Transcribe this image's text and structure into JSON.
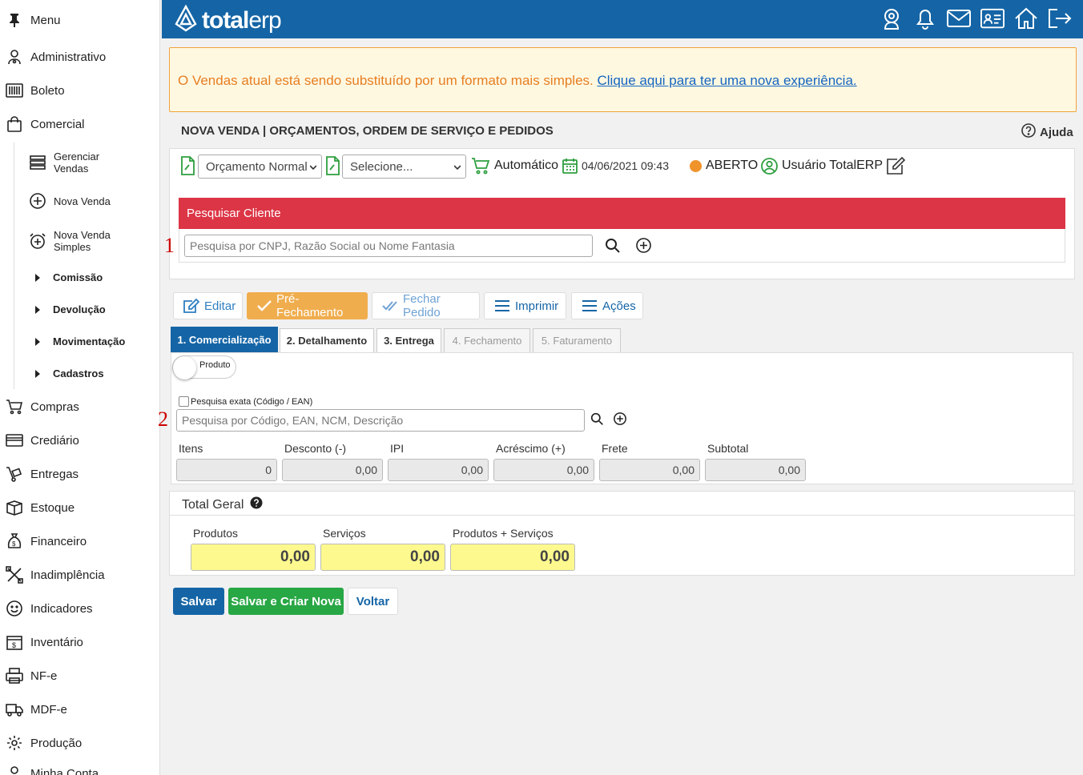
{
  "sidebar": {
    "menu_label": "Menu",
    "items": [
      {
        "label": "Administrativo",
        "icon": "admin-icon"
      },
      {
        "label": "Boleto",
        "icon": "barcode-icon"
      },
      {
        "label": "Comercial",
        "icon": "shopping-bag-icon"
      }
    ],
    "comercial_sub": [
      {
        "label": "Gerenciar Vendas",
        "icon": "list-icon"
      },
      {
        "label": "Nova Venda",
        "icon": "plus-circle-icon"
      },
      {
        "label": "Nova Venda Simples",
        "icon": "alarm-plus-icon"
      }
    ],
    "comercial_groups": [
      "Comissão",
      "Devolução",
      "Movimentação",
      "Cadastros"
    ],
    "items_after": [
      {
        "label": "Compras",
        "icon": "cart-icon"
      },
      {
        "label": "Crediário",
        "icon": "card-icon"
      },
      {
        "label": "Entregas",
        "icon": "dolly-icon"
      },
      {
        "label": "Estoque",
        "icon": "box-icon"
      },
      {
        "label": "Financeiro",
        "icon": "money-bag-icon"
      },
      {
        "label": "Inadimplência",
        "icon": "tools-icon"
      },
      {
        "label": "Indicadores",
        "icon": "smile-icon"
      },
      {
        "label": "Inventário",
        "icon": "inventory-icon"
      },
      {
        "label": "NF-e",
        "icon": "printer-icon"
      },
      {
        "label": "MDF-e",
        "icon": "truck-icon"
      },
      {
        "label": "Produção",
        "icon": "gear-icon"
      },
      {
        "label": "Minha Conta",
        "icon": "user-icon"
      }
    ]
  },
  "header": {
    "logo_bold": "total",
    "logo_light": "erp",
    "icons": [
      "support-icon",
      "bell-icon",
      "mail-icon",
      "id-card-icon",
      "home-icon",
      "logout-icon"
    ]
  },
  "notice": {
    "text": "O Vendas atual está sendo substituído por um formato mais simples. ",
    "link": "Clique aqui para ter uma nova experiência."
  },
  "page": {
    "title": "NOVA VENDA | ORÇAMENTOS, ORDEM DE SERVIÇO E PEDIDOS",
    "help": "Ajuda"
  },
  "order": {
    "type_value": "Orçamento Normal",
    "second_select": "Selecione...",
    "mode": "Automático",
    "datetime": "04/06/2021 09:43",
    "status": "ABERTO",
    "user": "Usuário TotalERP"
  },
  "client_search": {
    "title": "Pesquisar Cliente",
    "placeholder": "Pesquisa por CNPJ, Razão Social ou Nome Fantasia",
    "marker": "1"
  },
  "actions": {
    "edit": "Editar",
    "pre_close": "Pré-Fechamento",
    "close_order": "Fechar Pedido",
    "print": "Imprimir",
    "actions": "Ações"
  },
  "tabs": [
    "1. Comercialização",
    "2. Detalhamento",
    "3. Entrega",
    "4. Fechamento",
    "5. Faturamento"
  ],
  "product": {
    "toggle_label": "Produto",
    "exact_label": "Pesquisa exata (Código / EAN)",
    "placeholder": "Pesquisa por Código, EAN, NCM, Descrição",
    "marker": "2"
  },
  "totals": [
    {
      "label": "Itens",
      "value": "0"
    },
    {
      "label": "Desconto (-)",
      "value": "0,00"
    },
    {
      "label": "IPI",
      "value": "0,00"
    },
    {
      "label": "Acréscimo (+)",
      "value": "0,00"
    },
    {
      "label": "Frete",
      "value": "0,00"
    },
    {
      "label": "Subtotal",
      "value": "0,00"
    }
  ],
  "grand_total": {
    "title": "Total Geral",
    "fields": [
      {
        "label": "Produtos",
        "value": "0,00"
      },
      {
        "label": "Serviços",
        "value": "0,00"
      },
      {
        "label": "Produtos + Serviços",
        "value": "0,00"
      }
    ]
  },
  "footer": {
    "save": "Salvar",
    "save_new": "Salvar e Criar Nova",
    "back": "Voltar"
  },
  "colors": {
    "brand": "#1565a6",
    "danger": "#dc3545",
    "warning": "#f0ad4e",
    "success": "#28a745",
    "status_open": "#f0932b"
  }
}
